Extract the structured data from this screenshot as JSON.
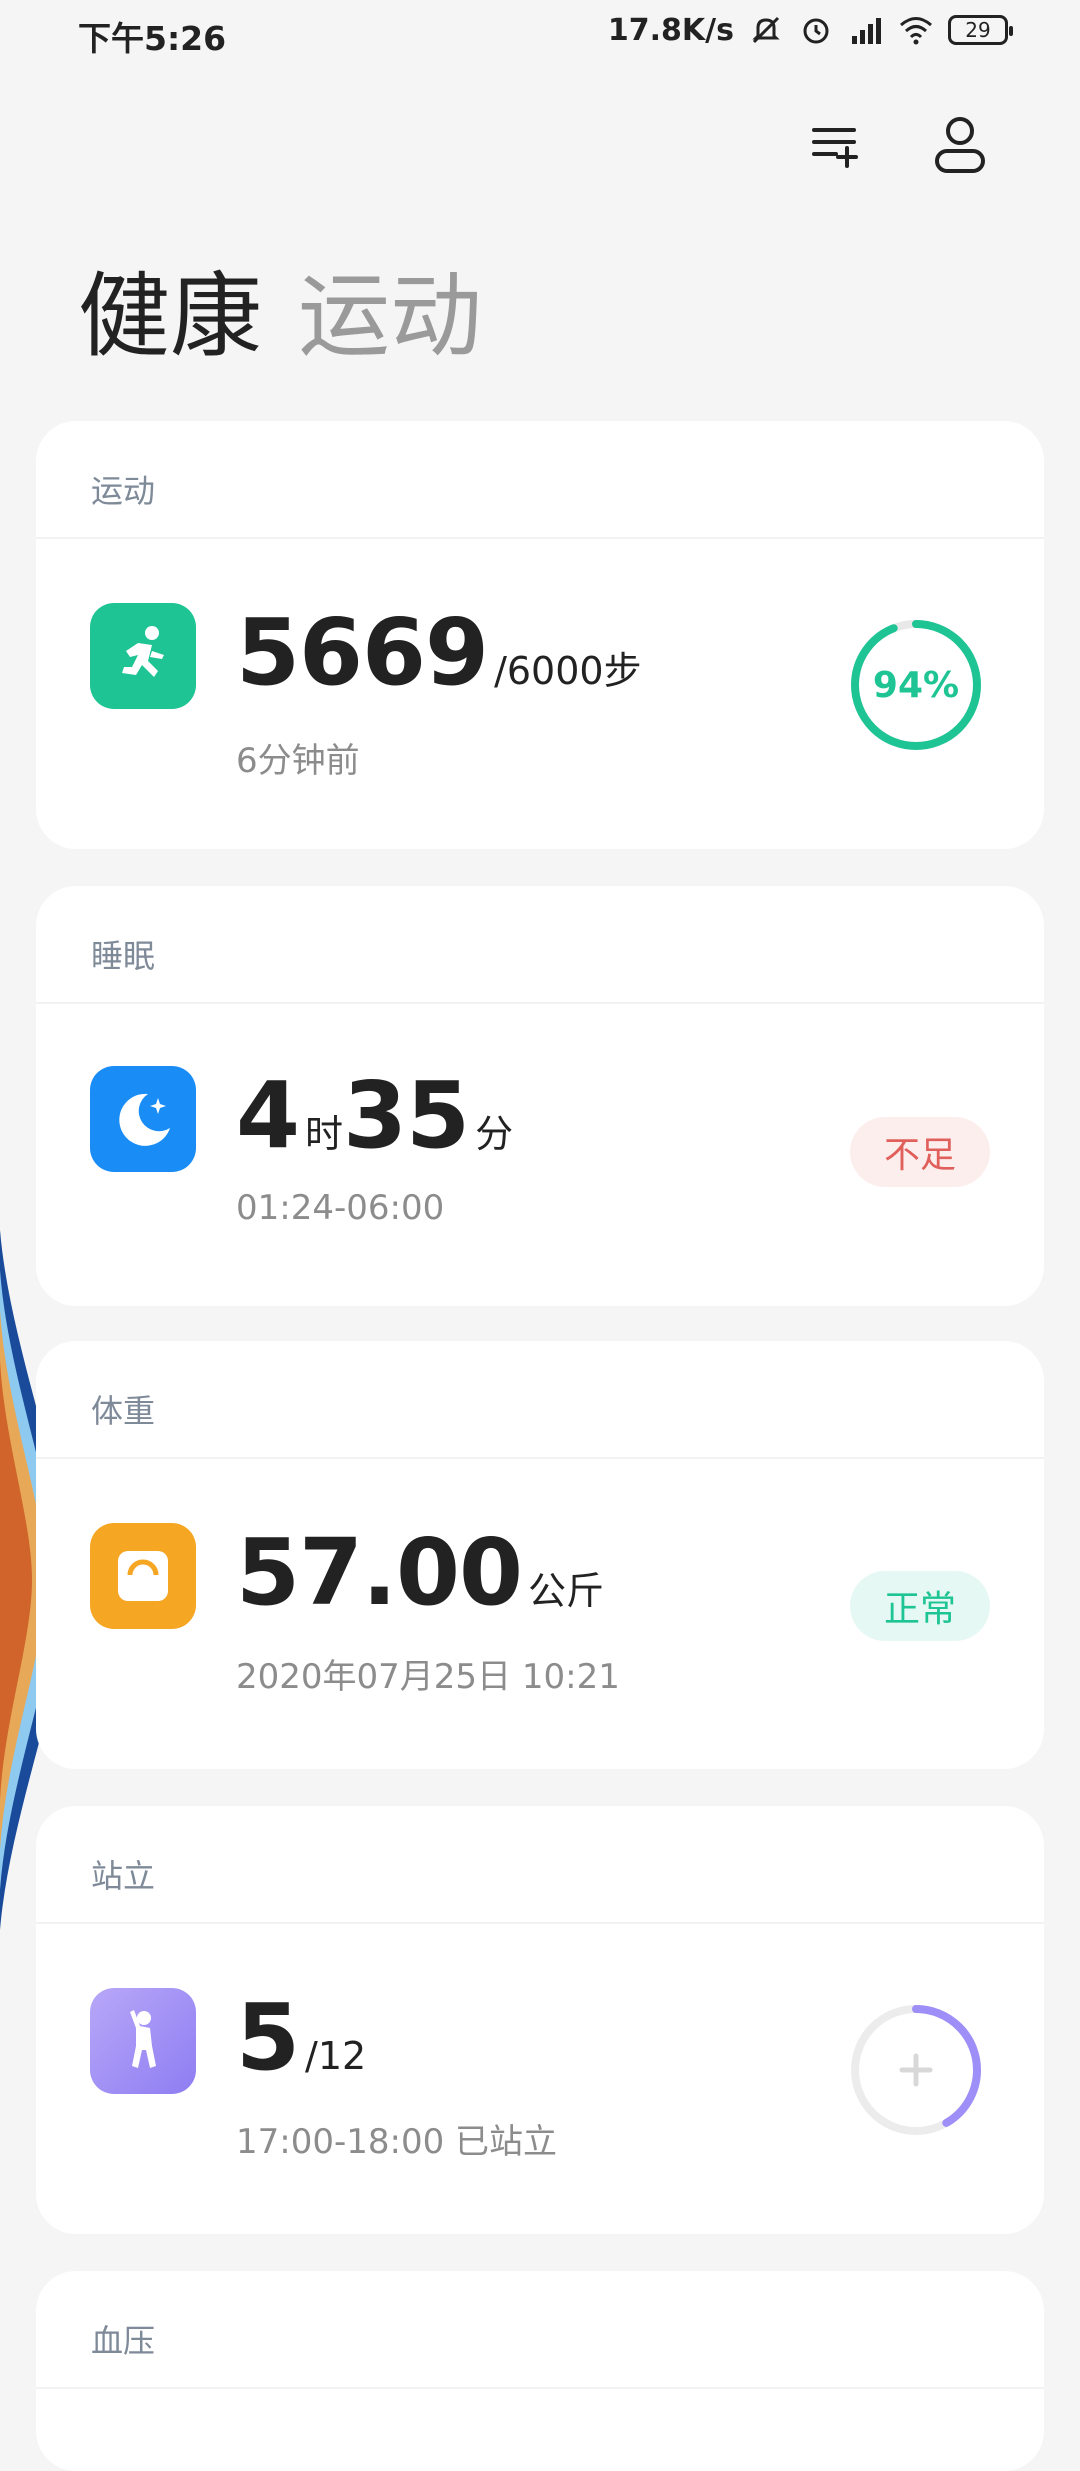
{
  "status_bar": {
    "time": "下午5:26",
    "net_speed": "17.8K/s",
    "battery": "29"
  },
  "header": {
    "tab_health": "健康",
    "tab_sport": "运动"
  },
  "cards": {
    "sport": {
      "title": "运动",
      "steps": "5669",
      "goal": "/6000步",
      "time_ago": "6分钟前",
      "progress_label": "94%",
      "progress": 0.94
    },
    "sleep": {
      "title": "睡眠",
      "hours": "4",
      "hours_unit": "时",
      "minutes": "35",
      "minutes_unit": "分",
      "range": "01:24-06:00",
      "status": "不足"
    },
    "weight": {
      "title": "体重",
      "value": "57.00",
      "unit": "公斤",
      "datetime": "2020年07月25日 10:21",
      "status": "正常"
    },
    "stand": {
      "title": "站立",
      "value": "5",
      "total": "/12",
      "detail": "17:00-18:00 已站立",
      "progress": 0.417
    },
    "blood_pressure": {
      "title": "血压"
    }
  },
  "colors": {
    "sport": "#1ec494",
    "sleep": "#1a8cf5",
    "weight": "#f5a623",
    "stand": "#9e8ef7",
    "warn_bg": "#fdeeee",
    "warn_text": "#e0605c",
    "ok_bg": "#e6f8f3",
    "ok_text": "#1ec494"
  }
}
